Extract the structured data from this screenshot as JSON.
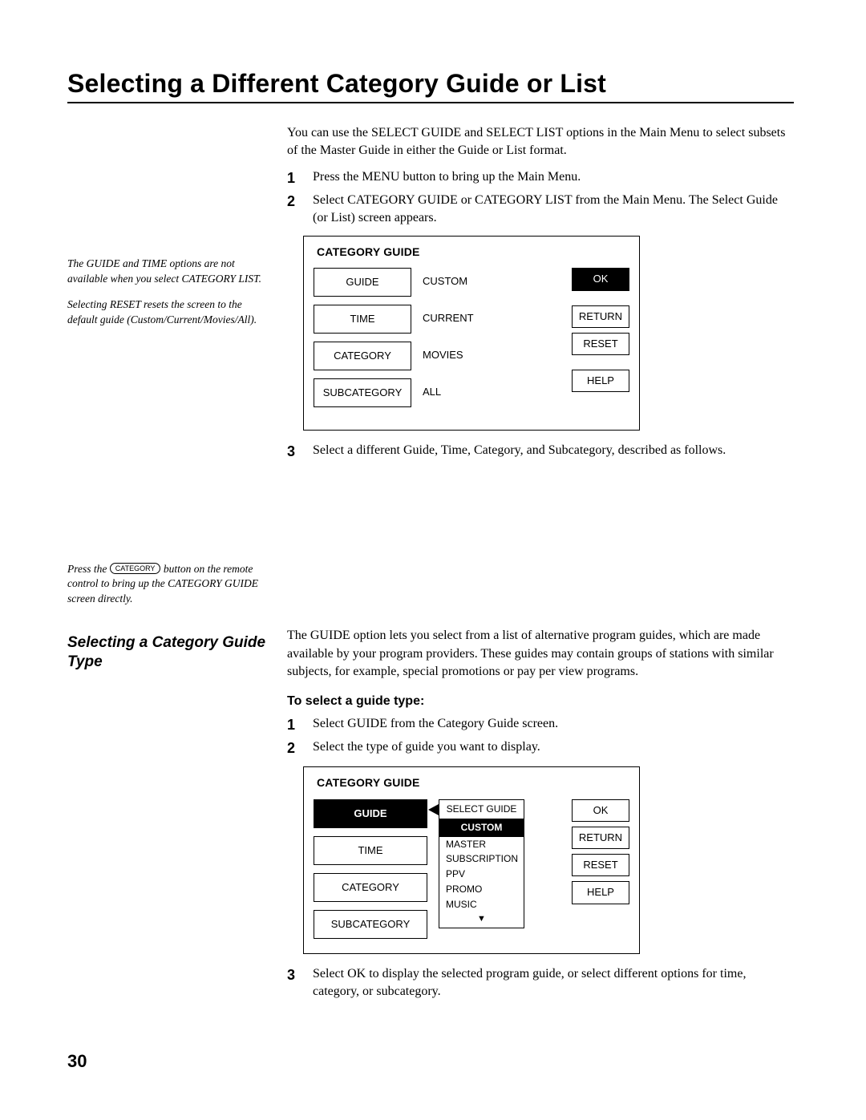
{
  "title": "Selecting a Different Category Guide or List",
  "intro": "You can use the SELECT GUIDE and SELECT LIST options in the Main Menu to select subsets of the Master Guide in either the Guide or List format.",
  "steps_a": {
    "1": "Press the MENU button to bring up the Main Menu.",
    "2": "Select CATEGORY GUIDE or CATEGORY LIST from the Main Menu. The Select Guide (or List) screen appears.",
    "3": "Select a different Guide, Time, Category, and Subcategory, described as follows."
  },
  "side": {
    "note1": "The GUIDE and TIME options are not available when you select CATEGORY LIST.",
    "note2": "Selecting RESET resets the screen to the default guide (Custom/Current/Movies/All).",
    "remote_pre": "Press the ",
    "remote_label": "CATEGORY",
    "remote_post": " button on the remote control to bring up the CATEGORY GUIDE screen directly."
  },
  "screen1": {
    "title": "CATEGORY GUIDE",
    "rows": {
      "r1a": "GUIDE",
      "r1b": "CUSTOM",
      "r2a": "TIME",
      "r2b": "CURRENT",
      "r3a": "CATEGORY",
      "r3b": "MOVIES",
      "r4a": "SUBCATEGORY",
      "r4b": "ALL"
    },
    "btns": {
      "ok": "OK",
      "return": "RETURN",
      "reset": "RESET",
      "help": "HELP"
    }
  },
  "subhead": "Selecting a Category Guide Type",
  "subtext": "The GUIDE option lets you select from a list of alternative program guides, which are made available by your program providers. These guides may contain groups of stations with similar subjects, for example, special promotions or pay per view programs.",
  "to_head": "To select a guide type:",
  "steps_b": {
    "1": "Select GUIDE from the Category Guide screen.",
    "2": "Select the type of guide you want to display.",
    "3": "Select OK to display the selected program guide, or select different options for time, category, or subcategory."
  },
  "screen2": {
    "title": "CATEGORY GUIDE",
    "left": {
      "guide": "GUIDE",
      "time": "TIME",
      "category": "CATEGORY",
      "subcategory": "SUBCATEGORY"
    },
    "popup": {
      "head": "SELECT GUIDE",
      "sel": "CUSTOM",
      "o1": "MASTER",
      "o2": "SUBSCRIPTION",
      "o3": "PPV",
      "o4": "PROMO",
      "o5": "MUSIC",
      "down": "▼"
    },
    "btns": {
      "ok": "OK",
      "return": "RETURN",
      "reset": "RESET",
      "help": "HELP"
    }
  },
  "page_num": "30"
}
